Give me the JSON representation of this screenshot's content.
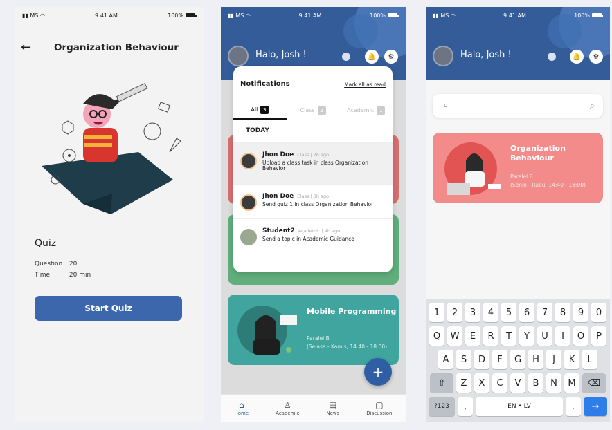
{
  "status": {
    "carrier": "MS",
    "time": "9:41 AM",
    "battery": "100%"
  },
  "quiz_screen": {
    "title": "Organization Behaviour",
    "quiz_heading": "Quiz",
    "question_label": "Question",
    "question_value": ": 20",
    "time_label": "Time",
    "time_value": ": 20 min",
    "start_button": "Start Quiz"
  },
  "home": {
    "greeting": "Halo, Josh !",
    "search_placeholder": "o",
    "course_cards": [
      {
        "title": "Organization Behaviour",
        "class": "Paralel B",
        "schedule": "(Senin - Rabu, 14:40 - 18:00)",
        "color": "#f48b8b"
      },
      {
        "title": "Mobile Programming",
        "class": "Paralel B",
        "schedule": "(Selasa - Kamis, 14:40 - 18:00)",
        "color": "#3fa59e"
      }
    ],
    "fab_label": "+",
    "nav": [
      {
        "label": "Home",
        "icon": "home-icon"
      },
      {
        "label": "Academic",
        "icon": "people-icon"
      },
      {
        "label": "News",
        "icon": "news-icon"
      },
      {
        "label": "Discussion",
        "icon": "chat-icon"
      }
    ]
  },
  "notifications": {
    "title": "Notifications",
    "mark_all": "Mark all as read",
    "tabs": [
      {
        "label": "All",
        "count": "3"
      },
      {
        "label": "Class",
        "count": "2"
      },
      {
        "label": "Academic",
        "count": "1"
      }
    ],
    "section": "TODAY",
    "items": [
      {
        "name": "Jhon Doe",
        "category": "Class",
        "time": "2h ago",
        "message": "Upload a class task in class Organization Behavior"
      },
      {
        "name": "Jhon Doe",
        "category": "Class",
        "time": "3h ago",
        "message": "Send quiz 1 in class Organization Behavior"
      },
      {
        "name": "Student2",
        "category": "Academic",
        "time": "4h ago",
        "message": "Send a topic in Academic Guidance"
      }
    ]
  },
  "keyboard": {
    "row1": [
      "1",
      "2",
      "3",
      "4",
      "5",
      "6",
      "7",
      "8",
      "9",
      "0"
    ],
    "row2": [
      "Q",
      "W",
      "E",
      "R",
      "T",
      "Y",
      "U",
      "I",
      "O",
      "P"
    ],
    "row3": [
      "A",
      "S",
      "D",
      "F",
      "G",
      "H",
      "J",
      "K",
      "L"
    ],
    "row4": [
      "Z",
      "X",
      "C",
      "V",
      "B",
      "N",
      "M"
    ],
    "sym_key": "?123",
    "comma": ",",
    "space": "EN • LV",
    "period": ".",
    "enter": "→",
    "shift": "⇧",
    "backspace": "⌫"
  },
  "colors": {
    "primary": "#345c99",
    "accent": "#2f5ea5",
    "red_card": "#f48b8b",
    "teal_card": "#3fa59e",
    "green_card": "#5fae7b"
  }
}
